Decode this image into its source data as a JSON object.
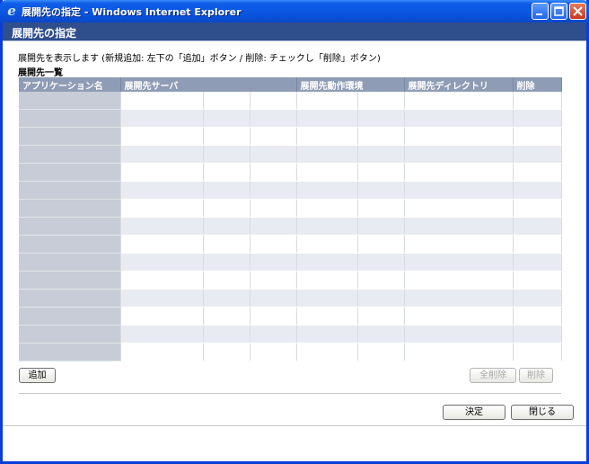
{
  "window": {
    "title": "展開先の指定 - Windows Internet Explorer",
    "icon": "ie-icon",
    "controls": [
      "minimize-icon",
      "maximize-icon",
      "close-icon"
    ]
  },
  "header": {
    "title": "展開先の指定"
  },
  "description": "展開先を表示します (新規追加: 左下の「追加」ボタン / 削除: チェックし「削除」ボタン)",
  "list": {
    "title": "展開先一覧",
    "columns": [
      "アプリケーション名",
      "展開先サーバ",
      "",
      "",
      "展開先動作環境",
      "",
      "展開先ディレクトリ",
      "削除"
    ],
    "row_count": 15
  },
  "buttons": {
    "add": "追加",
    "delete_all": "全削除",
    "delete": "削除",
    "ok": "決定",
    "close": "閉じる"
  },
  "colors": {
    "titlebar": "#0a55e0",
    "header": "#2f4e8c",
    "grid_header": "#8f9cb5"
  }
}
